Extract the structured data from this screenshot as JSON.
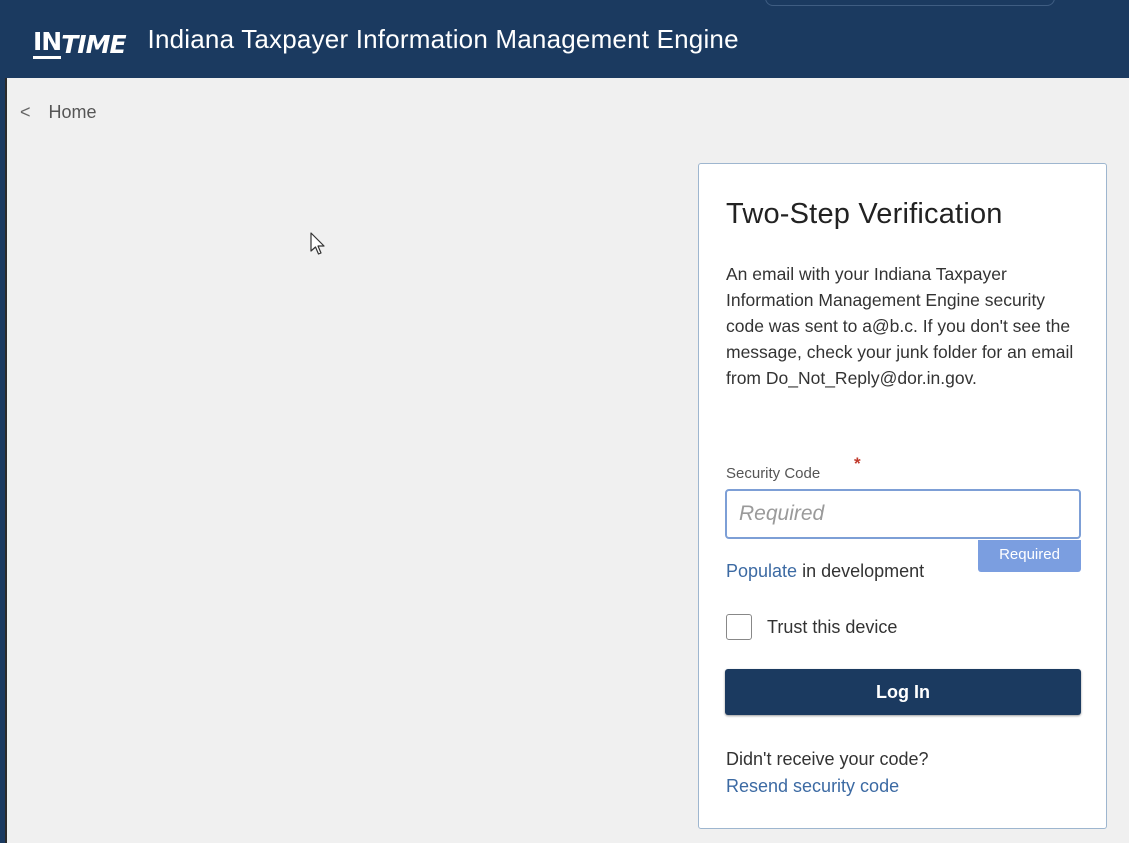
{
  "header": {
    "logo_in": "IN",
    "logo_time": "TIME",
    "title": "Indiana Taxpayer Information Management Engine",
    "background_color": "#1b3a60"
  },
  "breadcrumb": {
    "back_icon": "chevron-left-icon",
    "label": "Home"
  },
  "card": {
    "title": "Two-Step Verification",
    "description": "An email with your Indiana Taxpayer Information Management Engine security code was sent to a@b.c. If you don't see the message, check your junk folder for an email from Do_Not_Reply@dor.in.gov.",
    "security_code": {
      "label": "Security Code",
      "required_marker": "*",
      "value": "",
      "placeholder": "Required",
      "badge": "Required"
    },
    "populate_link": "Populate",
    "populate_suffix": " in development",
    "trust_device": {
      "label": "Trust this device",
      "checked": false
    },
    "login_button": "Log In",
    "didnt_receive": "Didn't receive your code?",
    "resend_link": "Resend security code"
  },
  "colors": {
    "accent": "#1b3a60",
    "link": "#3c6aa3",
    "badge": "#7b9ee0",
    "required": "#c0392b"
  }
}
